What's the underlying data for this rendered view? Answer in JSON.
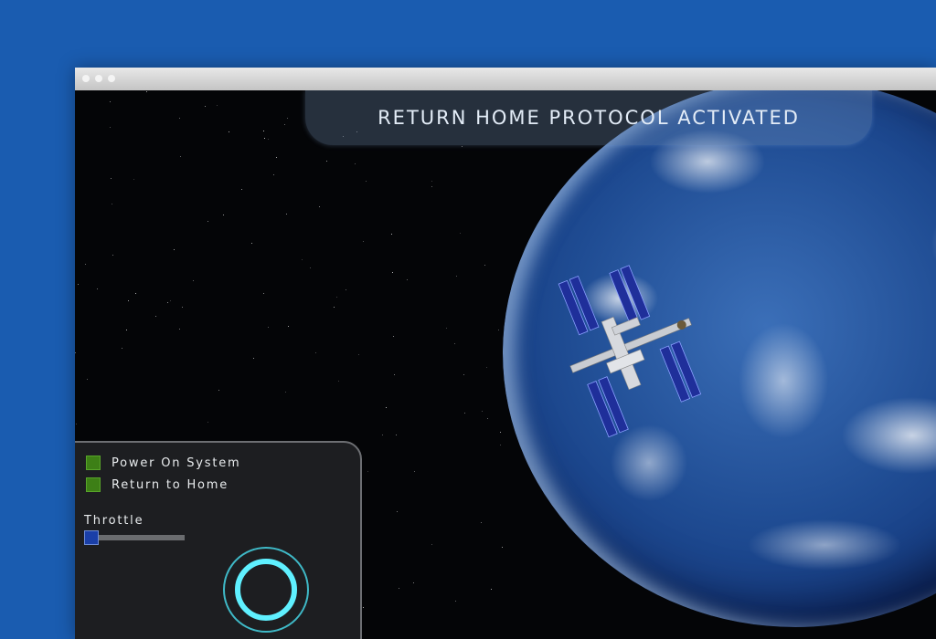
{
  "window": {
    "dots": [
      "dot-1",
      "dot-2",
      "dot-3"
    ]
  },
  "banner": {
    "text": "RETURN HOME PROTOCOL ACTIVATED"
  },
  "controls": {
    "checkboxes": [
      {
        "label": "Power On System",
        "checked": true
      },
      {
        "label": "Return to Home",
        "checked": true
      }
    ],
    "throttle": {
      "label": "Throttle",
      "value_fraction": 0.0
    },
    "dial_icon": "ring-dial-icon"
  },
  "colors": {
    "background": "#1a5cb0",
    "checkbox_green": "#3d7f16",
    "slider_thumb": "#1a3fa8",
    "dial_cyan": "#5ff0ff"
  }
}
